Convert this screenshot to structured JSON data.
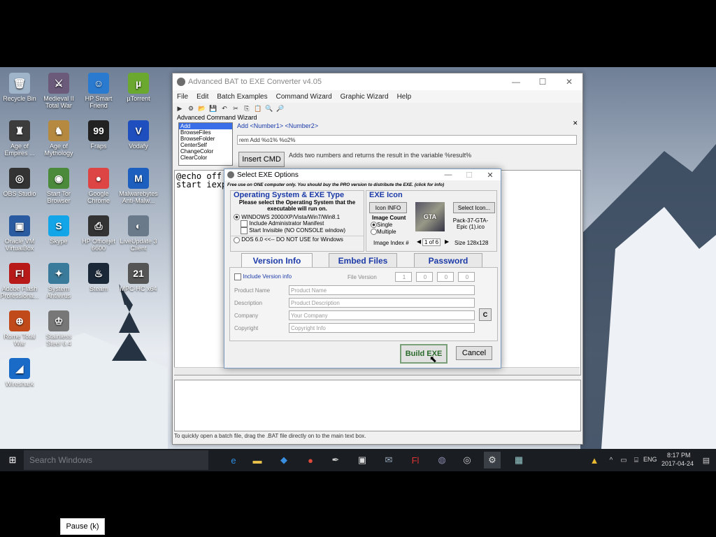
{
  "desktop_icons": [
    {
      "label": "Recycle Bin",
      "icon": "recycle-bin-icon",
      "color": "#9fb4c8",
      "glyph": "🗑"
    },
    {
      "label": "Medieval II Total War",
      "icon": "medieval-icon",
      "color": "#6b5a7a",
      "glyph": "⚔"
    },
    {
      "label": "HP Smart Friend",
      "icon": "hp-smart-icon",
      "color": "#2a7ad0",
      "glyph": "☺"
    },
    {
      "label": "µTorrent",
      "icon": "utorrent-icon",
      "color": "#6aa830",
      "glyph": "µ"
    },
    {
      "label": "Age of Empires ...",
      "icon": "aoe-icon",
      "color": "#3c3c3c",
      "glyph": "♜"
    },
    {
      "label": "Age of Mythology",
      "icon": "aom-icon",
      "color": "#b58a40",
      "glyph": "♞"
    },
    {
      "label": "Fraps",
      "icon": "fraps-icon",
      "color": "#222",
      "glyph": "99"
    },
    {
      "label": "Vodafy",
      "icon": "vodafy-icon",
      "color": "#1f4fbf",
      "glyph": "V"
    },
    {
      "label": "OBS Studio",
      "icon": "obs-icon",
      "color": "#333",
      "glyph": "◎"
    },
    {
      "label": "Start Tor Browser",
      "icon": "tor-icon",
      "color": "#4a8a3a",
      "glyph": "◉"
    },
    {
      "label": "Google Chrome",
      "icon": "chrome-icon",
      "color": "#d44",
      "glyph": "●"
    },
    {
      "label": "Malwarebytes Anti-Malw...",
      "icon": "malwarebytes-icon",
      "color": "#1d5fbf",
      "glyph": "M"
    },
    {
      "label": "Oracle VM VirtualBox",
      "icon": "virtualbox-icon",
      "color": "#2a5aa0",
      "glyph": "▣"
    },
    {
      "label": "Skype",
      "icon": "skype-icon",
      "color": "#12a5e8",
      "glyph": "S"
    },
    {
      "label": "HP Officejet 6600",
      "icon": "hp-printer-icon",
      "color": "#333",
      "glyph": "⎙"
    },
    {
      "label": "LiveUpdate 3 Client",
      "icon": "liveupdate-icon",
      "color": "#6a7a8a",
      "glyph": "◐"
    },
    {
      "label": "Adobe Flash Professiona...",
      "icon": "flash-icon",
      "color": "#b81a1a",
      "glyph": "Fl"
    },
    {
      "label": "System Antivirus",
      "icon": "antivirus-icon",
      "color": "#3a7a9a",
      "glyph": "✦"
    },
    {
      "label": "Steam",
      "icon": "steam-icon",
      "color": "#1b2838",
      "glyph": "♨"
    },
    {
      "label": "MPC-HC x64",
      "icon": "mpc-icon",
      "color": "#555",
      "glyph": "21"
    },
    {
      "label": "Rome Total War",
      "icon": "rome-icon",
      "color": "#c04a1a",
      "glyph": "⊕"
    },
    {
      "label": "Stainless Steel 6.4",
      "icon": "stainless-icon",
      "color": "#777",
      "glyph": "♔"
    },
    {
      "label": "Wireshark",
      "icon": "wireshark-icon",
      "color": "#1a6ac8",
      "glyph": "◢"
    }
  ],
  "main_window": {
    "title": "Advanced BAT to EXE Converter v4.05",
    "menu": [
      "File",
      "Edit",
      "Batch Examples",
      "Command Wizard",
      "Graphic Wizard",
      "Help"
    ],
    "wizard_label": "Advanced Command Wizard",
    "commands": [
      "Add",
      "BrowseFiles",
      "BrowseFolder",
      "CenterSelf",
      "ChangeColor",
      "ClearColor"
    ],
    "syntax": "Add  <Number1>  <Number2>",
    "command_input": "rem Add %o1% %o2%",
    "insert_button": "Insert CMD",
    "command_help": "Adds two numbers and returns the result in the variable %result%",
    "editor_lines": [
      "@echo off",
      "start iexp"
    ],
    "status": "To quickly open a batch file, drag the .BAT file directly on to the main text box."
  },
  "dialog": {
    "title": "Select EXE Options",
    "notice": "Free use on ONE computer only. You should buy the PRO version to distribute the EXE. (click for info)",
    "os_group_title": "Operating System & EXE Type",
    "os_prompt": "Please select the Operating System that the executable will run on.",
    "os_options": {
      "windows": "WINDOWS  2000/XP/Vista/Win7/Win8.1",
      "admin": "Include Administrator Manifest",
      "invisible": "Start Invisible  (NO CONSOLE window)",
      "dos": "DOS 6.0 <<-- DO NOT USE for Windows"
    },
    "icon_group_title": "EXE Icon",
    "icon_info_button": "Icon INFO",
    "select_icon_button": "Select Icon...",
    "image_count_label": "Image Count",
    "single": "Single",
    "multiple": "Multiple",
    "image_index_label": "Image Index #",
    "image_index_value": "1 of 6",
    "icon_file": "Pack-37-GTA-Epic (1).ico",
    "icon_size": "Size  128x128",
    "tabs": [
      "Version Info",
      "Embed Files",
      "Password"
    ],
    "include_version": "Include Version info",
    "file_version_label": "File Version",
    "file_version": [
      "1",
      "0",
      "0",
      "0"
    ],
    "fields": [
      {
        "label": "Product Name",
        "placeholder": "Product Name"
      },
      {
        "label": "Description",
        "placeholder": "Product Description"
      },
      {
        "label": "Company",
        "placeholder": "Your Company"
      },
      {
        "label": "Copyright",
        "placeholder": "Copyright Info"
      }
    ],
    "refresh_button": "C",
    "build_button": "Build EXE",
    "cancel_button": "Cancel"
  },
  "taskbar": {
    "search_placeholder": "Search Windows",
    "lang": "ENG",
    "time": "8:17 PM",
    "date": "2017-04-24"
  },
  "video_overlay": {
    "pause_label": "Pause (k)"
  },
  "colors": {
    "accent_blue": "#1b3aa8",
    "selection": "#3a6ee8",
    "taskbar": "#1a1d22"
  }
}
